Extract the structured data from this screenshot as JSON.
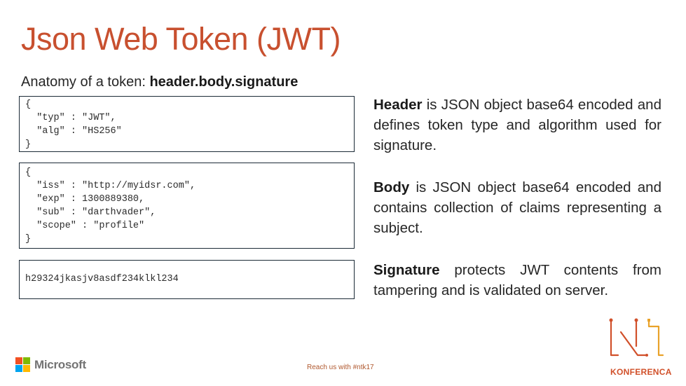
{
  "slide": {
    "title": "Json Web Token (JWT)",
    "subtitle_prefix": "Anatomy of a token: ",
    "subtitle_emphasis": "header.body.signature"
  },
  "code_boxes": [
    {
      "id": "header",
      "code": "{\n  \"typ\" : \"JWT\",\n  \"alg\" : \"HS256\"\n}"
    },
    {
      "id": "body",
      "code": "{\n  \"iss\" : \"http://myidsr.com\",\n  \"exp\" : 1300889380,\n  \"sub\" : \"darthvader\",\n  \"scope\" : \"profile\"\n}"
    },
    {
      "id": "signature",
      "code": "h29324jkasjv8asdf234klkl234"
    }
  ],
  "descriptions": [
    {
      "term": "Header",
      "text": " is JSON object base64 encoded and defines token type and algorithm used for signature."
    },
    {
      "term": "Body",
      "text": " is JSON object base64 encoded and contains collection of claims representing a subject."
    },
    {
      "term": "Signature",
      "text": " protects JWT contents from tampering and is validated on server."
    }
  ],
  "footer": {
    "brand_logo_text": "Microsoft",
    "brand_logo_icon": "microsoft-logo-icon",
    "ms_colors": [
      "#f25022",
      "#7fba00",
      "#00a4ef",
      "#ffb900"
    ],
    "reach_text": "Reach us with #ntk17",
    "conference_logo_icon": "ntk-logo-icon",
    "conference_text": "KONFERENCA"
  },
  "colors": {
    "title": "#c8502f",
    "accent_orange": "#d1502a",
    "accent_yellow": "#e9a22a"
  }
}
